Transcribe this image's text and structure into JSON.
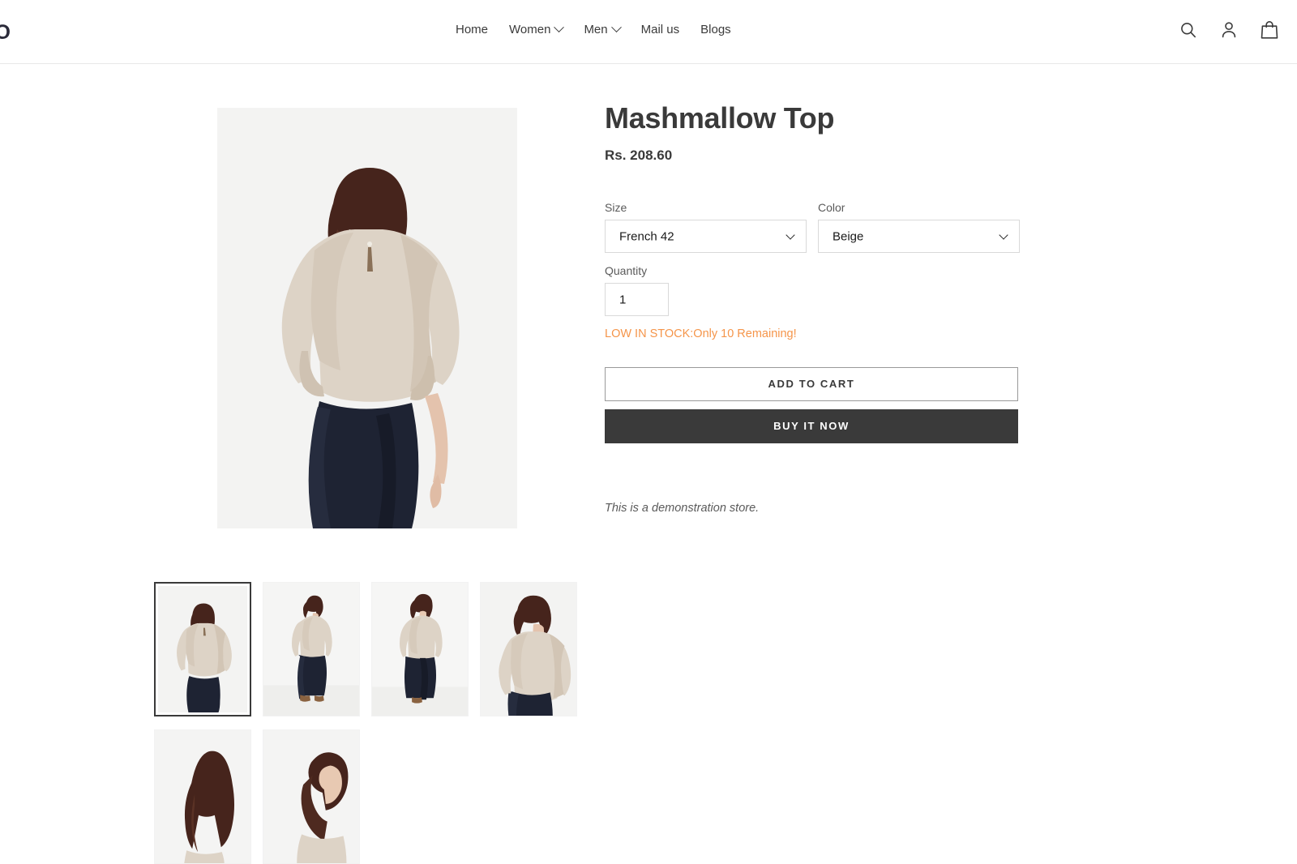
{
  "header": {
    "logo": "IO",
    "nav": [
      {
        "label": "Home",
        "has_chevron": false
      },
      {
        "label": "Women",
        "has_chevron": true
      },
      {
        "label": "Men",
        "has_chevron": true
      },
      {
        "label": "Mail us",
        "has_chevron": false
      },
      {
        "label": "Blogs",
        "has_chevron": false
      }
    ],
    "icons": [
      {
        "name": "search-icon"
      },
      {
        "name": "account-icon"
      },
      {
        "name": "cart-icon"
      }
    ]
  },
  "product": {
    "title": "Mashmallow Top",
    "price": "Rs. 208.60",
    "size": {
      "label": "Size",
      "value": "French 42"
    },
    "color": {
      "label": "Color",
      "value": "Beige"
    },
    "quantity": {
      "label": "Quantity",
      "value": "1"
    },
    "stock_message": "LOW IN STOCK:Only 10 Remaining!",
    "add_to_cart_label": "ADD TO CART",
    "buy_now_label": "BUY IT NOW",
    "demo_note": "This is a demonstration store."
  },
  "gallery": {
    "main_alt": "Model back view wearing beige Mashmallow Top with navy trousers",
    "thumbnails": [
      {
        "alt": "Back view of beige top",
        "selected": true,
        "view": "back"
      },
      {
        "alt": "Side profile full length",
        "selected": false,
        "view": "side-full"
      },
      {
        "alt": "Front view full length",
        "selected": false,
        "view": "front-full"
      },
      {
        "alt": "Side view cropped",
        "selected": false,
        "view": "side-crop"
      },
      {
        "alt": "Back detail close up",
        "selected": false,
        "view": "back-detail"
      },
      {
        "alt": "Neckline close up",
        "selected": false,
        "view": "neck-detail"
      }
    ]
  },
  "colors": {
    "accent_stock": "#f5954a",
    "button_dark": "#3a3a3a",
    "text": "#3a3a3a",
    "border": "#d9d9d9",
    "photo_bg": "#f2f2f2",
    "garment": "#ddd3c6",
    "trousers": "#1e2333",
    "hair": "#4a2a22"
  }
}
